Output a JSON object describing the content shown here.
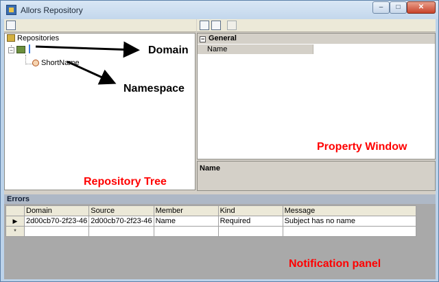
{
  "window": {
    "title": "Allors Repository",
    "close_glyph": "✕",
    "minimize_glyph": "–",
    "maximize_glyph": "□"
  },
  "tree": {
    "root_label": "Repositories",
    "domain_expander": "−",
    "namespace_label": "ShortName"
  },
  "properties": {
    "category": "General",
    "category_toggle": "−",
    "rows": [
      {
        "name": "Name",
        "value": ""
      }
    ],
    "description_title": "Name"
  },
  "errors": {
    "header": "Errors",
    "columns": [
      "Domain",
      "Source",
      "Member",
      "Kind",
      "Message"
    ],
    "rows": [
      {
        "indicator": "▶",
        "domain": "2d00cb70-2f23-46",
        "source": "2d00cb70-2f23-46",
        "member": "Name",
        "kind": "Required",
        "message": "Subject has no name"
      }
    ],
    "new_row_indicator": "*"
  },
  "annotations": {
    "domain": "Domain",
    "namespace": "Namespace",
    "property_window": "Property Window",
    "repository_tree": "Repository Tree",
    "notification_panel": "Notification panel"
  },
  "colors": {
    "annotation_red": "#ff0000",
    "titlebar": "#c9dbee",
    "panel_gray": "#d4d0c8"
  }
}
